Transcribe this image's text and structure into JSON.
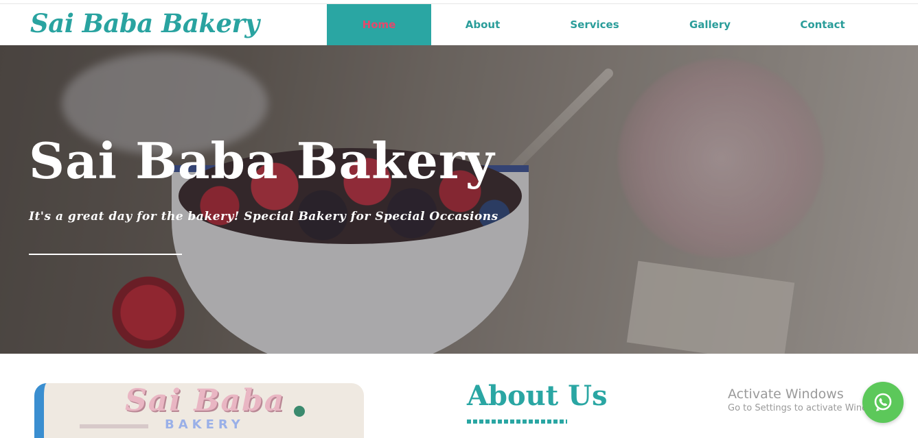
{
  "brand": {
    "name": "Sai Baba Bakery"
  },
  "nav": {
    "items": [
      {
        "label": "Home",
        "active": true
      },
      {
        "label": "About",
        "active": false
      },
      {
        "label": "Services",
        "active": false
      },
      {
        "label": "Gallery",
        "active": false
      },
      {
        "label": "Contact",
        "active": false
      }
    ]
  },
  "hero": {
    "title": "Sai Baba Bakery",
    "subtitle": "It's a great day for the bakery! Special Bakery for Special Occasions"
  },
  "about": {
    "title": "About Us",
    "photo_sign": "Sai Baba",
    "photo_sign_sub": "BAKERY"
  },
  "overlay": {
    "activate_title": "Activate Windows",
    "activate_sub": "Go to Settings to activate Windows."
  },
  "whatsapp": {
    "icon": "whatsapp-icon"
  },
  "colors": {
    "accent": "#2aa6a3",
    "active_text": "#e5486b",
    "whatsapp": "#5cc85a"
  }
}
